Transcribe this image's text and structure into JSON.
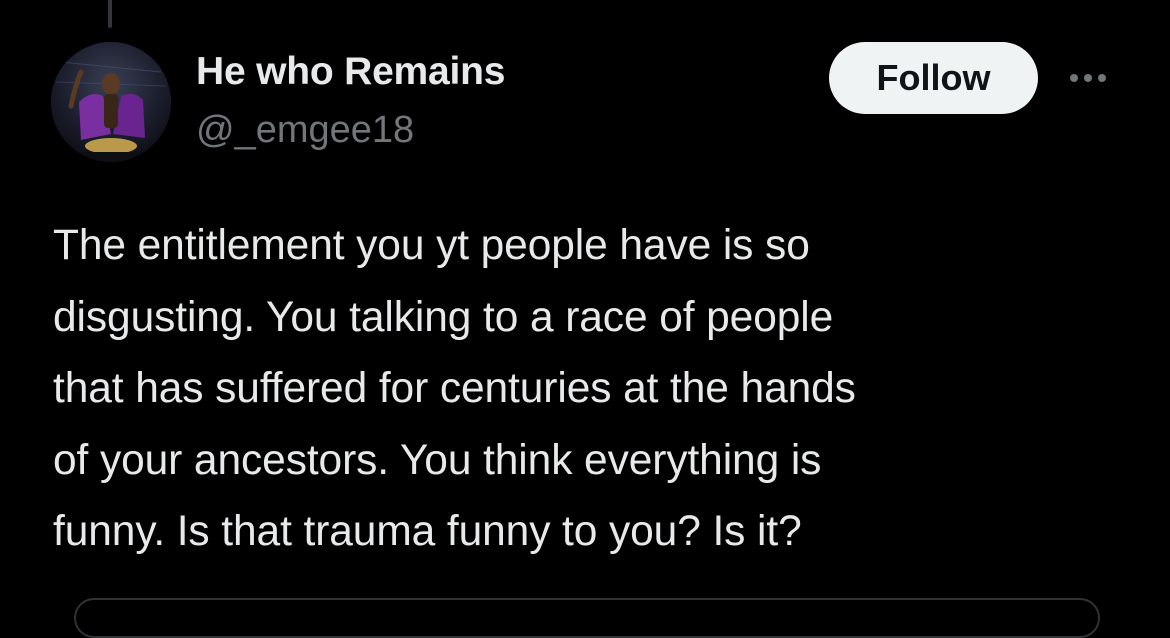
{
  "tweet": {
    "author": {
      "display_name": "He who Remains",
      "handle": "@_emgee18",
      "avatar_icon": "user-avatar"
    },
    "follow_label": "Follow",
    "more_icon": "more-horizontal-icon",
    "text_lines": [
      "The entitlement you yt people have is so",
      "disgusting. You talking to a race of people",
      "that has suffered for centuries at the hands",
      "of your ancestors. You think everything is",
      "funny. Is that trauma funny to you? Is it?"
    ]
  },
  "colors": {
    "background": "#000000",
    "primary_text": "#e7e9ea",
    "secondary_text": "#71767b",
    "follow_button_bg": "#eff3f4",
    "follow_button_text": "#0f1419",
    "border": "#2f3336"
  }
}
